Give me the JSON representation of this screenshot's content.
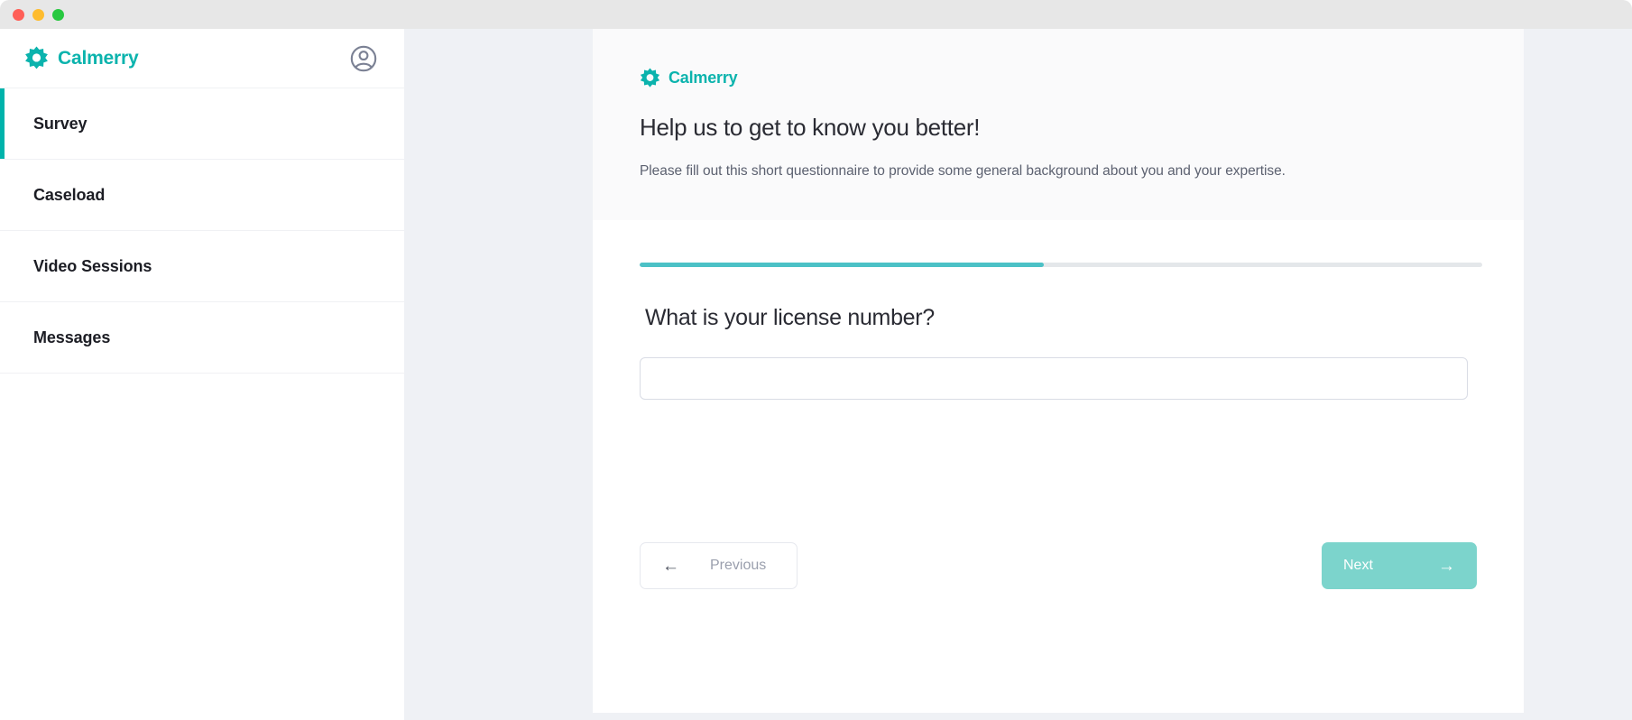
{
  "window": {
    "traffic_lights": [
      {
        "name": "close",
        "color": "#ff5f57"
      },
      {
        "name": "minimize",
        "color": "#febc2e"
      },
      {
        "name": "zoom",
        "color": "#28c840"
      }
    ]
  },
  "theme": {
    "brand_teal": "#0bb3ad",
    "accent_active": "#00b3ab",
    "progress_fill": "#4cc1c6",
    "progress_track": "#e4e7ea",
    "next_button_bg": "#7cd4cc",
    "page_bg": "#eff1f5",
    "card_header_bg": "#fafafb"
  },
  "sidebar": {
    "brand": {
      "name": "Calmerry",
      "mark_icon": "calmerry-flower-icon"
    },
    "avatar_icon": "user-circle-icon",
    "items": [
      {
        "label": "Survey",
        "active": true
      },
      {
        "label": "Caseload",
        "active": false
      },
      {
        "label": "Video Sessions",
        "active": false
      },
      {
        "label": "Messages",
        "active": false
      }
    ]
  },
  "card": {
    "brand": {
      "name": "Calmerry",
      "mark_icon": "calmerry-flower-icon"
    },
    "title": "Help us to get to know you better!",
    "subtitle": "Please fill out this short questionnaire to provide some general background about you and your expertise.",
    "progress": {
      "percent": 48,
      "label": "48%"
    },
    "question": "What is your license number?",
    "answer": {
      "value": "",
      "placeholder": ""
    },
    "footer": {
      "previous": {
        "label": "Previous",
        "icon": "arrow-left-icon",
        "arrow": "←"
      },
      "next": {
        "label": "Next",
        "icon": "arrow-right-icon",
        "arrow": "→"
      }
    }
  }
}
